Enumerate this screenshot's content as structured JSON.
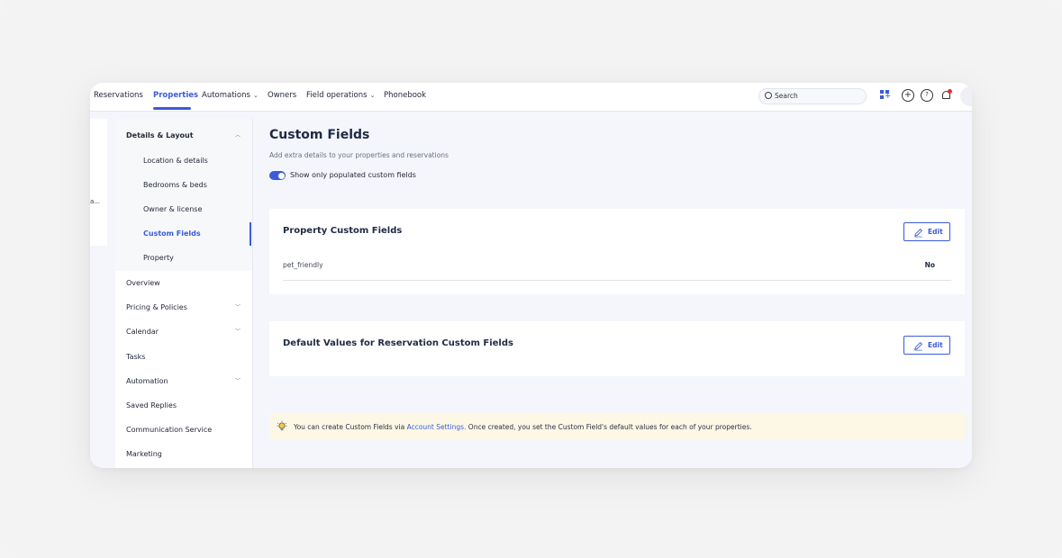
{
  "nav": {
    "items": [
      {
        "label": "Reservations",
        "active": false,
        "dropdown": false
      },
      {
        "label": "Properties",
        "active": true,
        "dropdown": false
      },
      {
        "label": "Automations",
        "active": false,
        "dropdown": true
      },
      {
        "label": "Owners",
        "active": false,
        "dropdown": false
      },
      {
        "label": "Field operations",
        "active": false,
        "dropdown": true
      },
      {
        "label": "Phonebook",
        "active": false,
        "dropdown": false
      }
    ],
    "search_placeholder": "Search",
    "accent": "#3b5bdb"
  },
  "left_panel": {
    "truncated_text": "a..."
  },
  "sidebar": {
    "group": {
      "label": "Details & Layout",
      "expanded": true
    },
    "sub_items": [
      {
        "label": "Location & details"
      },
      {
        "label": "Bedrooms & beds"
      },
      {
        "label": "Owner & license"
      },
      {
        "label": "Custom Fields",
        "active": true
      },
      {
        "label": "Property"
      }
    ],
    "items": [
      {
        "label": "Overview",
        "dropdown": false
      },
      {
        "label": "Pricing & Policies",
        "dropdown": true
      },
      {
        "label": "Calendar",
        "dropdown": true
      },
      {
        "label": "Tasks",
        "dropdown": false
      },
      {
        "label": "Automation",
        "dropdown": true
      },
      {
        "label": "Saved Replies",
        "dropdown": false
      },
      {
        "label": "Communication Service",
        "dropdown": false
      },
      {
        "label": "Marketing",
        "dropdown": false
      }
    ]
  },
  "main": {
    "title": "Custom Fields",
    "subtitle": "Add extra details to your properties and reservations",
    "toggle": {
      "label": "Show only populated custom fields",
      "on": true
    },
    "property_card": {
      "title": "Property Custom Fields",
      "edit_label": "Edit",
      "fields": [
        {
          "name": "pet_friendly",
          "value": "No"
        }
      ]
    },
    "reservation_card": {
      "title": "Default Values for Reservation Custom Fields",
      "edit_label": "Edit"
    },
    "notice": {
      "prefix": "You can create Custom Fields via ",
      "link": "Account Settings.",
      "suffix": " Once created, you set the Custom Field's default values for each of your properties."
    }
  }
}
